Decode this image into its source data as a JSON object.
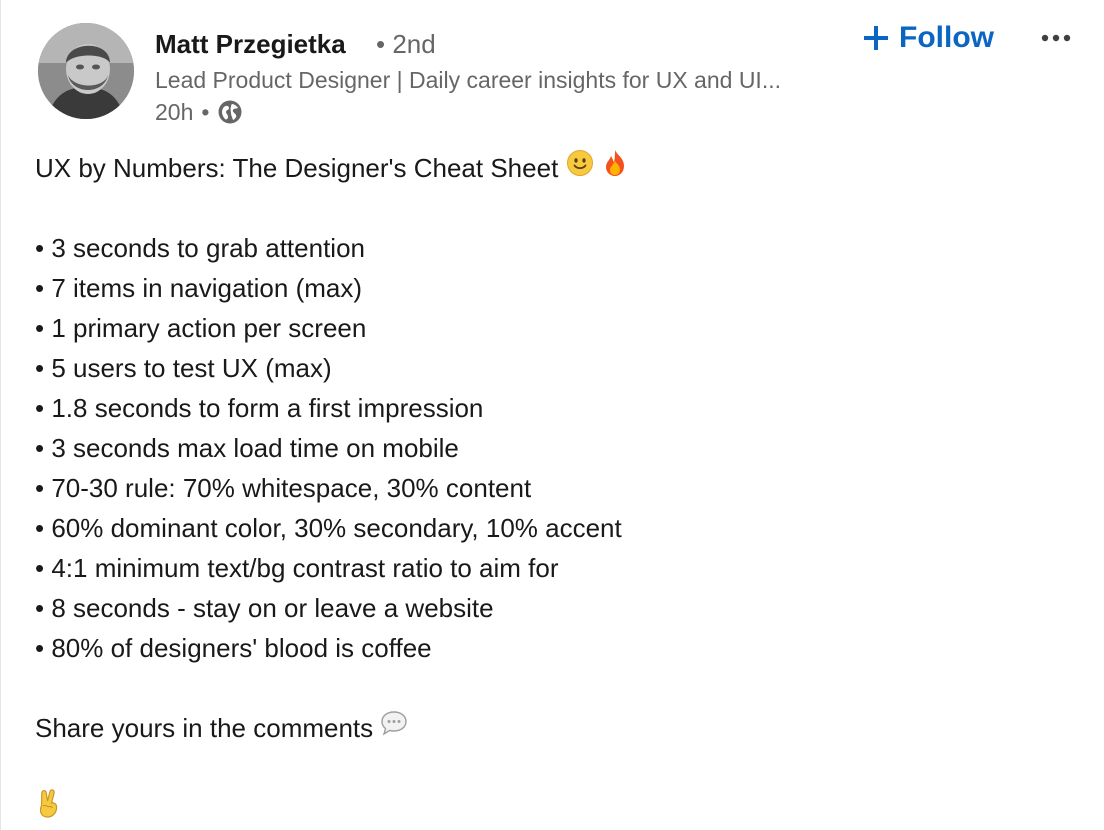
{
  "post": {
    "author": {
      "name": "Matt Przegietka",
      "degree_separator": "•",
      "degree": "2nd",
      "headline": "Lead Product Designer | Daily career insights for UX and UI...",
      "time": "20h",
      "visibility_icon": "globe-icon"
    },
    "actions": {
      "follow_label": "Follow",
      "follow_icon": "plus-icon",
      "more_icon": "more-options-icon"
    },
    "title": "UX by Numbers: The Designer's Cheat Sheet",
    "title_emojis": [
      "slightly-smiling-face-icon",
      "fire-icon"
    ],
    "bullets": [
      "• 3 seconds to grab attention",
      "• 7 items in navigation (max)",
      "• 1 primary action per screen",
      "• 5 users to test UX (max)",
      "• 1.8 seconds to form a first impression",
      "• 3 seconds max load time on mobile",
      "• 70-30 rule: 70% whitespace, 30% content",
      "• 60% dominant color, 30% secondary, 10% accent",
      "• 4:1 minimum text/bg contrast ratio to aim for",
      "• 8 seconds - stay on or leave a website",
      "• 80% of designers' blood is coffee"
    ],
    "cta": "Share yours in the comments",
    "cta_icon": "speech-balloon-icon",
    "closing_icon": "victory-hand-icon"
  },
  "colors": {
    "link_blue": "#0a66c2",
    "text_primary": "#191919",
    "text_secondary": "#666666"
  }
}
